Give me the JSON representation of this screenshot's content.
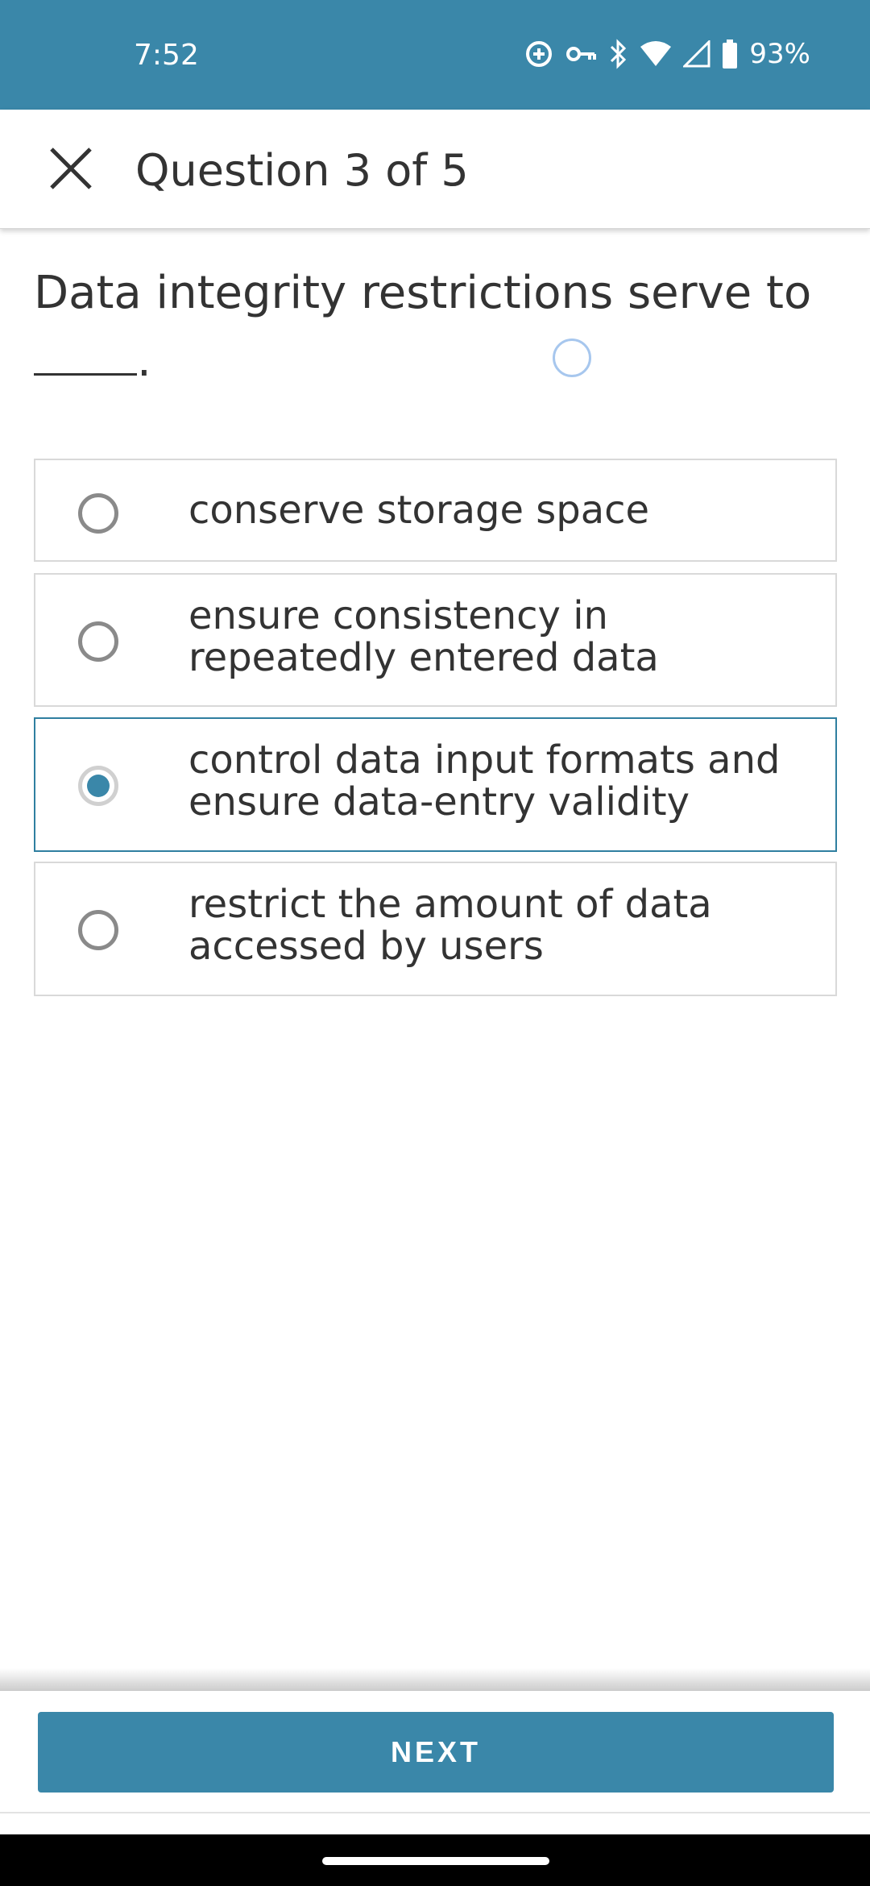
{
  "status_bar": {
    "time": "7:52",
    "battery_percent": "93%",
    "icons": [
      "sync-add-icon",
      "vpn-key-icon",
      "bluetooth-icon",
      "wifi-icon",
      "cell-signal-icon",
      "battery-icon"
    ],
    "background_color": "#3a87a9"
  },
  "app_bar": {
    "close_icon": "close-icon",
    "title": "Question 3 of 5"
  },
  "question": {
    "text": "Data integrity restrictions serve to",
    "blank_suffix": "."
  },
  "options": [
    {
      "label": "conserve storage space",
      "selected": false
    },
    {
      "label": "ensure consistency in repeatedly entered data",
      "selected": false
    },
    {
      "label": "control data input formats and ensure data-entry validity",
      "selected": true
    },
    {
      "label": "restrict the amount of data accessed by users",
      "selected": false
    }
  ],
  "footer": {
    "next_label": "NEXT",
    "accent_color": "#3a87a9"
  }
}
